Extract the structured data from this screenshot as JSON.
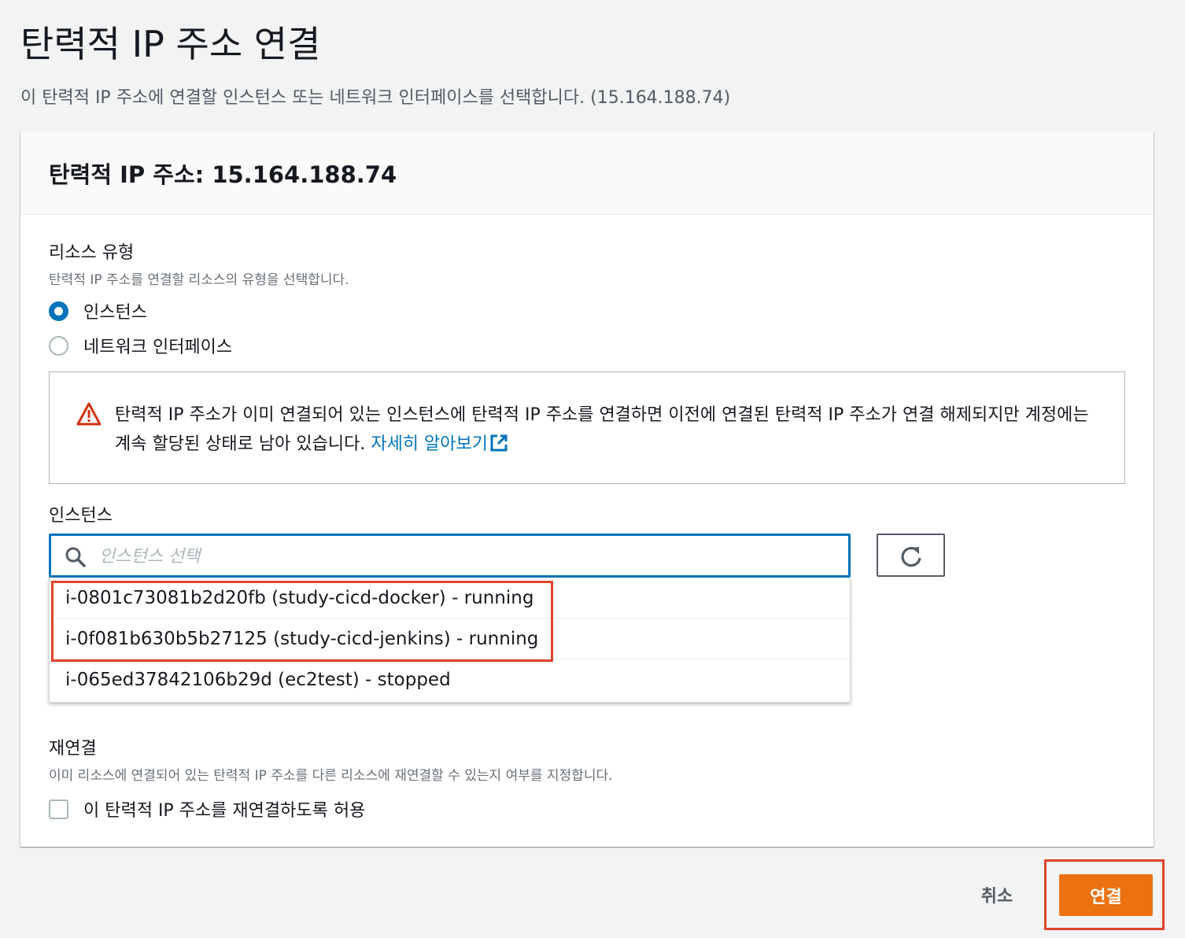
{
  "page": {
    "title": "탄력적 IP 주소 연결",
    "description": "이 탄력적 IP 주소에 연결할 인스턴스 또는 네트워크 인터페이스를 선택합니다. (15.164.188.74)"
  },
  "panel": {
    "header": "탄력적 IP 주소: 15.164.188.74"
  },
  "resource_type": {
    "label": "리소스 유형",
    "description": "탄력적 IP 주소를 연결할 리소스의 유형을 선택합니다.",
    "options": [
      {
        "label": "인스턴스",
        "checked": true
      },
      {
        "label": "네트워크 인터페이스",
        "checked": false
      }
    ]
  },
  "warning": {
    "text": "탄력적 IP 주소가 이미 연결되어 있는 인스턴스에 탄력적 IP 주소를 연결하면 이전에 연결된 탄력적 IP 주소가 연결 해제되지만 계정에는 계속 할당된 상태로 남아 있습니다. ",
    "link": "자세히 알아보기",
    "icon": "warning-icon"
  },
  "instance": {
    "label": "인스턴스",
    "search_placeholder": "인스턴스 선택",
    "options": [
      "i-0801c73081b2d20fb (study-cicd-docker) - running",
      "i-0f081b630b5b27125 (study-cicd-jenkins) - running",
      "i-065ed37842106b29d (ec2test) - stopped"
    ]
  },
  "reassociate": {
    "label": "재연결",
    "description": "이미 리소스에 연결되어 있는 탄력적 IP 주소를 다른 리소스에 재연결할 수 있는지 여부를 지정합니다.",
    "checkbox_label": "이 탄력적 IP 주소를 재연결하도록 허용",
    "checked": false
  },
  "actions": {
    "cancel": "취소",
    "submit": "연결"
  },
  "colors": {
    "accent": "#0073bb",
    "primary_button": "#ec7211",
    "highlight": "#e0442b",
    "warning": "#d13212"
  }
}
